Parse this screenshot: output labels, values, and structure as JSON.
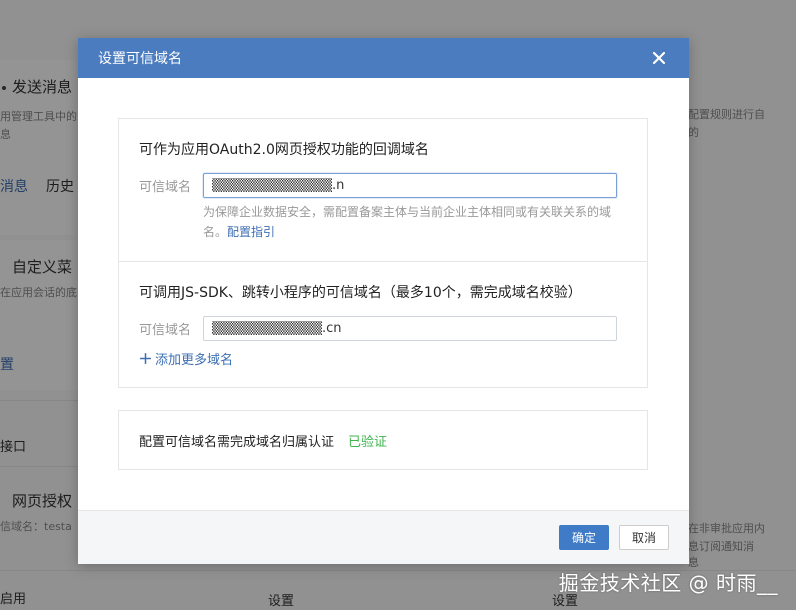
{
  "background": {
    "left_cards": [
      {
        "title": "发送消息",
        "desc": "用管理工具中的",
        "desc2": "息",
        "links": [
          "消息",
          "历史"
        ]
      },
      {
        "title": "自定义菜",
        "desc": "在应用会话的底",
        "link": "置"
      },
      {
        "item": "接口"
      },
      {
        "title": "网页授权",
        "desc": "信域名：testa"
      }
    ],
    "right_snippets": [
      "配置规则进行自",
      "的",
      "在非审批应用内",
      "息订阅通知消",
      "息"
    ],
    "bottom_links": [
      "启用",
      "设置",
      "设置"
    ]
  },
  "modal": {
    "title": "设置可信域名",
    "close_icon": "close-icon",
    "oauth": {
      "heading": "可作为应用OAuth2.0网页授权功能的回调域名",
      "label": "可信域名",
      "value": "▒▒▒▒▒▒▒▒▒▒▒▒.n",
      "hint": "为保障企业数据安全，需配置备案主体与当前企业主体相同或有关联关系的域名。",
      "hint_link": "配置指引"
    },
    "jssdk": {
      "heading": "可调用JS-SDK、跳转小程序的可信域名（最多10个，需完成域名校验）",
      "label": "可信域名",
      "value": "▒▒▒▒▒▒▒▒▒▒▒.cn",
      "add_more": "添加更多域名"
    },
    "verify": {
      "text": "配置可信域名需完成域名归属认证",
      "status": "已验证",
      "status_color": "#3fb54f"
    },
    "footer": {
      "confirm": "确定",
      "cancel": "取消"
    }
  },
  "watermark": "掘金技术社区 @ 时雨__",
  "colors": {
    "header": "#4a7cbf",
    "primary": "#3f7bc6",
    "link": "#3d6fb3"
  }
}
